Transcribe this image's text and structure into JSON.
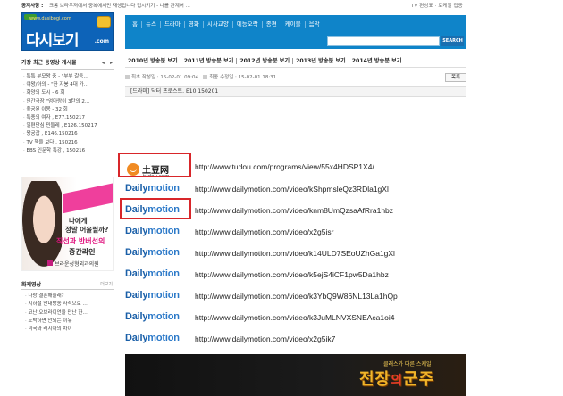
{
  "topbar": {
    "notice_label": "공지사항 :",
    "notice_text": "크롬 브라우저에서 중복에서만 재생됩니다 접시키기 - 나를 관계어 ...",
    "links": "TV 편성표 · 로케일 접종"
  },
  "logo": {
    "site": "www.dasibogi.com",
    "name": "다시보기",
    "dotcom": ".com"
  },
  "nav": {
    "items": [
      "홈",
      "뉴스",
      "드라마",
      "영화",
      "시사교양",
      "예능오락",
      "종편",
      "케이블",
      "음악"
    ]
  },
  "search": {
    "button_label": "SEARCH",
    "placeholder": ""
  },
  "years": [
    "2010년 방송분 보기",
    "2011년 방송분 보기",
    "2012년 방송분 보기",
    "2013년 방송분 보기",
    "2014년 방송분 보기"
  ],
  "sidebar": {
    "title": "가장 최근 등영상 게시물",
    "arrows": "◂ ▸",
    "items": [
      "특특 부모왕 중 - \"부부 갈등…",
      "야왕/아의 - \"한 지붕 4대 가…",
      "화양의 도시 - 6 회",
      "인간극장 \"엄마랑이 3탄의 2…",
      "좋궁된 이몽 - 32 회",
      "특종의 여자 , E77.150217",
      "일편단심 민들레 , E126.150217",
      "왕궁갑 , E146.150216",
      "TV 책을 보다 , 150216",
      "EBS 인문학 특강 , 150216"
    ]
  },
  "ad": {
    "line1": "나에게",
    "line2": "정말 어울릴까?",
    "line3": "직선과 반버선의",
    "line4": "중간라인",
    "clinic": "브라운성형외과의원"
  },
  "box2": {
    "title": "화제영상",
    "more": "더보기",
    "items": [
      "나랑 결혼해줄래?",
      "지하철 안내방송 사적으로 …",
      "코난 오브라이언을 만난 한…",
      "도박하면 안되는 이유",
      "미국과 러시아의 차이"
    ]
  },
  "post": {
    "created": "최초 작성일 : 15-02-01 09:04",
    "modified": "최종 수정일 : 15-02-01 18:31",
    "list_button": "목록",
    "title": "[드라마] 닥터 프로스트. E10.150201"
  },
  "links": [
    {
      "site": "tudou",
      "logo_name": "土豆网",
      "logo_domain": "tudou.com",
      "url": "http://www.tudou.com/programs/view/55x4HDSP1X4/",
      "highlighted": true
    },
    {
      "site": "dailymotion",
      "url": "http://www.dailymotion.com/video/kShpmsleQz3RDla1gXl",
      "highlighted": false
    },
    {
      "site": "dailymotion",
      "url": "http://www.dailymotion.com/video/knm8UmQzsaAfRra1hbz",
      "highlighted": true
    },
    {
      "site": "dailymotion",
      "url": "http://www.dailymotion.com/video/x2g5isr",
      "highlighted": false
    },
    {
      "site": "dailymotion",
      "url": "http://www.dailymotion.com/video/k14ULD7SEoUZhGa1gXl",
      "highlighted": false
    },
    {
      "site": "dailymotion",
      "url": "http://www.dailymotion.com/video/k5ejS4iCF1pw5Da1hbz",
      "highlighted": false
    },
    {
      "site": "dailymotion",
      "url": "http://www.dailymotion.com/video/k3YbQ9W86NL13La1hQp",
      "highlighted": false
    },
    {
      "site": "dailymotion",
      "url": "http://www.dailymotion.com/video/k3JuMLNVXSNEAca1oi4",
      "highlighted": false
    },
    {
      "site": "dailymotion",
      "url": "http://www.dailymotion.com/video/x2g5ik7",
      "highlighted": false
    }
  ],
  "dailymotion_logo": {
    "part1": "Daily",
    "part2": "motion"
  },
  "banner": {
    "tag": "클래스가 다른 스케일",
    "big1": "전장",
    "big_de": "의",
    "big2": "군주"
  },
  "colors": {
    "nav": "#0f84c9",
    "highlight": "#d8262a",
    "dailymotion": "#1a5fa8"
  }
}
